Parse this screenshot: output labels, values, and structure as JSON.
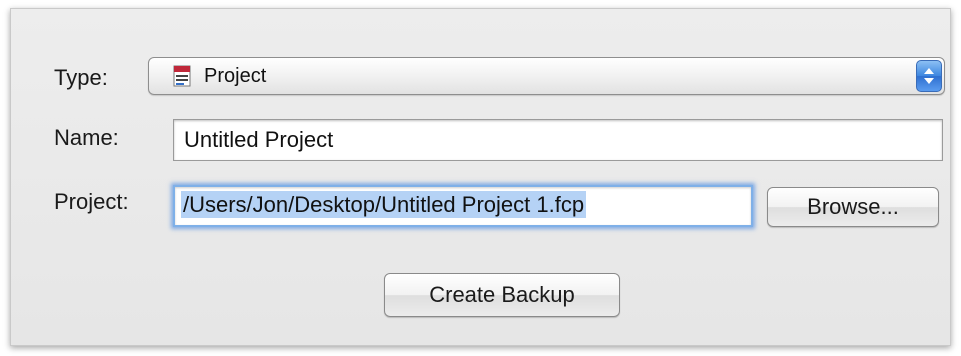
{
  "form": {
    "type_label": "Type:",
    "type_value": "Project",
    "type_icon": "project-document-icon",
    "name_label": "Name:",
    "name_value": "Untitled Project",
    "project_label": "Project:",
    "project_value": "/Users/Jon/Desktop/Untitled Project 1.fcp",
    "browse_label": "Browse...",
    "create_label": "Create Backup"
  },
  "colors": {
    "panel_bg": "#e9e9e9",
    "selection": "#b5d2f5",
    "focus_ring": "#7fb0e8",
    "stepper_blue": "#3d86e0"
  }
}
